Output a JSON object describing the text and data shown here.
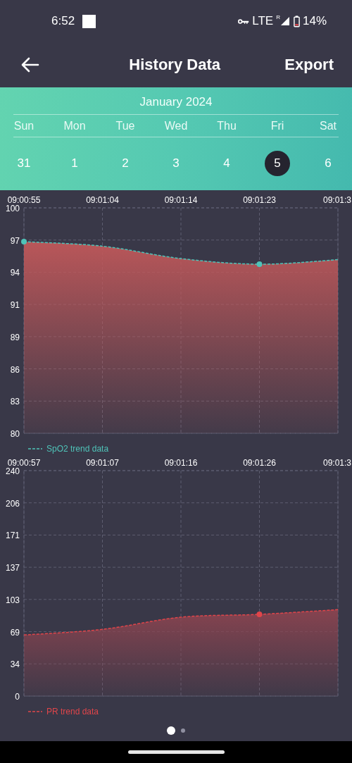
{
  "status_bar": {
    "time": "6:52",
    "network": "LTE",
    "roaming": "R",
    "battery": "14%"
  },
  "header": {
    "title": "History Data",
    "action": "Export"
  },
  "calendar": {
    "month": "January 2024",
    "weekdays": [
      "Sun",
      "Mon",
      "Tue",
      "Wed",
      "Thu",
      "Fri",
      "Sat"
    ],
    "days": [
      {
        "label": "31",
        "selected": false
      },
      {
        "label": "1",
        "selected": false
      },
      {
        "label": "2",
        "selected": false
      },
      {
        "label": "3",
        "selected": false
      },
      {
        "label": "4",
        "selected": false
      },
      {
        "label": "5",
        "selected": true
      },
      {
        "label": "6",
        "selected": false
      }
    ]
  },
  "charts": [
    {
      "chart_data": {
        "type": "area",
        "grid": true,
        "categories": [
          "09:00:55",
          "09:01:04",
          "09:01:14",
          "09:01:23",
          "09:01:3"
        ],
        "ylim": [
          80,
          100
        ],
        "yticks": [
          {
            "value": 80,
            "label": "80"
          },
          {
            "value": 82.857,
            "label": "83"
          },
          {
            "value": 85.714,
            "label": "86"
          },
          {
            "value": 88.571,
            "label": "89"
          },
          {
            "value": 91.429,
            "label": "91"
          },
          {
            "value": 94.286,
            "label": "94"
          },
          {
            "value": 97.143,
            "label": "97"
          },
          {
            "value": 100,
            "label": "100"
          }
        ],
        "series": [
          {
            "name": "SpO2 trend data",
            "color": "#4fc3b8",
            "values": [
              97.0,
              96.6,
              95.5,
              95.0,
              95.4
            ]
          }
        ]
      }
    },
    {
      "chart_data": {
        "type": "area",
        "grid": true,
        "categories": [
          "09:00:57",
          "09:01:07",
          "09:01:16",
          "09:01:26",
          "09:01:3"
        ],
        "ylim": [
          0,
          240
        ],
        "yticks": [
          {
            "value": 0,
            "label": "0"
          },
          {
            "value": 34.286,
            "label": "34"
          },
          {
            "value": 68.571,
            "label": "69"
          },
          {
            "value": 102.857,
            "label": "103"
          },
          {
            "value": 137.143,
            "label": "137"
          },
          {
            "value": 171.429,
            "label": "171"
          },
          {
            "value": 205.714,
            "label": "206"
          },
          {
            "value": 240,
            "label": "240"
          }
        ],
        "series": [
          {
            "name": "PR trend data",
            "color": "#e0454a",
            "values": [
              65,
              71,
              84,
              87,
              92
            ]
          }
        ]
      }
    }
  ],
  "pager": [
    {
      "selected": true
    },
    {
      "selected": false
    }
  ]
}
